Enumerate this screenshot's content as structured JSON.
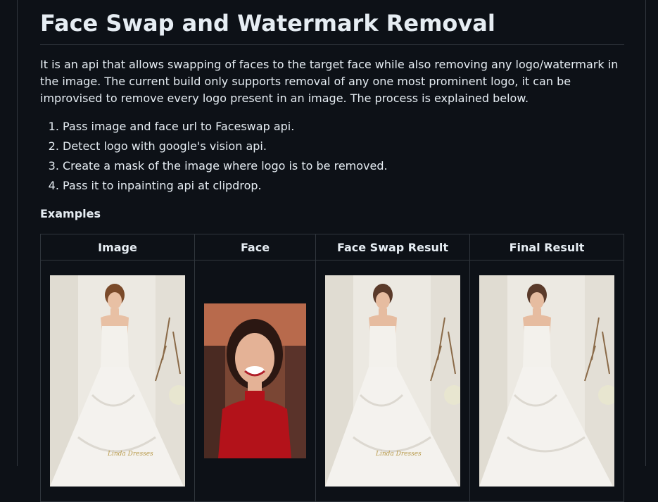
{
  "title": "Face Swap and Watermark Removal",
  "intro": "It is an api that allows swapping of faces to the target face while also removing any logo/watermark in the image. The current build only supports removal of any one most prominent logo, it can be improvised to remove every logo present in an image. The process is explained below.",
  "steps": [
    "Pass image and face url to Faceswap api.",
    "Detect logo with google's vision api.",
    "Create a mask of the image where logo is to be removed.",
    "Pass it to inpainting api at clipdrop."
  ],
  "examples_heading": "Examples",
  "table": {
    "headers": [
      "Image",
      "Face",
      "Face Swap Result",
      "Final Result"
    ]
  },
  "watermark_text": "Linda Dresses"
}
